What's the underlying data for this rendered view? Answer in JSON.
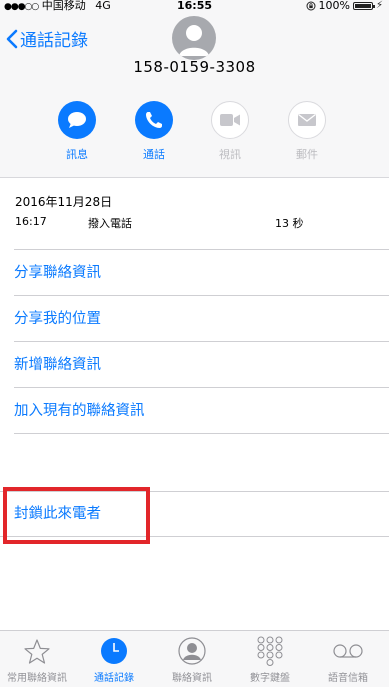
{
  "status_bar": {
    "signal": "●●●○○",
    "carrier": "中国移动",
    "network": "4G",
    "time": "16:55",
    "battery_percent": "100%",
    "battery_level": 1.0
  },
  "nav": {
    "back_label": "通話記錄"
  },
  "contact": {
    "phone_number": "158-0159-3308"
  },
  "actions": [
    {
      "label": "訊息",
      "icon": "message-bubble-icon",
      "enabled": true
    },
    {
      "label": "通話",
      "icon": "phone-icon",
      "enabled": true
    },
    {
      "label": "視訊",
      "icon": "video-camera-icon",
      "enabled": false
    },
    {
      "label": "郵件",
      "icon": "mail-envelope-icon",
      "enabled": false
    }
  ],
  "call_log": {
    "date": "2016年11月28日",
    "entries": [
      {
        "time": "16:17",
        "type": "撥入電話",
        "duration": "13 秒"
      }
    ]
  },
  "options": [
    "分享聯絡資訊",
    "分享我的位置",
    "新增聯絡資訊",
    "加入現有的聯絡資訊"
  ],
  "block_caller": "封鎖此來電者",
  "colors": {
    "accent": "#0a7aff",
    "highlight": "#e2262a"
  },
  "tabs": [
    {
      "label": "常用聯絡資訊",
      "icon": "star-icon",
      "active": false
    },
    {
      "label": "通話記錄",
      "icon": "clock-icon",
      "active": true
    },
    {
      "label": "聯絡資訊",
      "icon": "contact-person-icon",
      "active": false
    },
    {
      "label": "數字鍵盤",
      "icon": "keypad-icon",
      "active": false
    },
    {
      "label": "語音信箱",
      "icon": "voicemail-icon",
      "active": false
    }
  ]
}
